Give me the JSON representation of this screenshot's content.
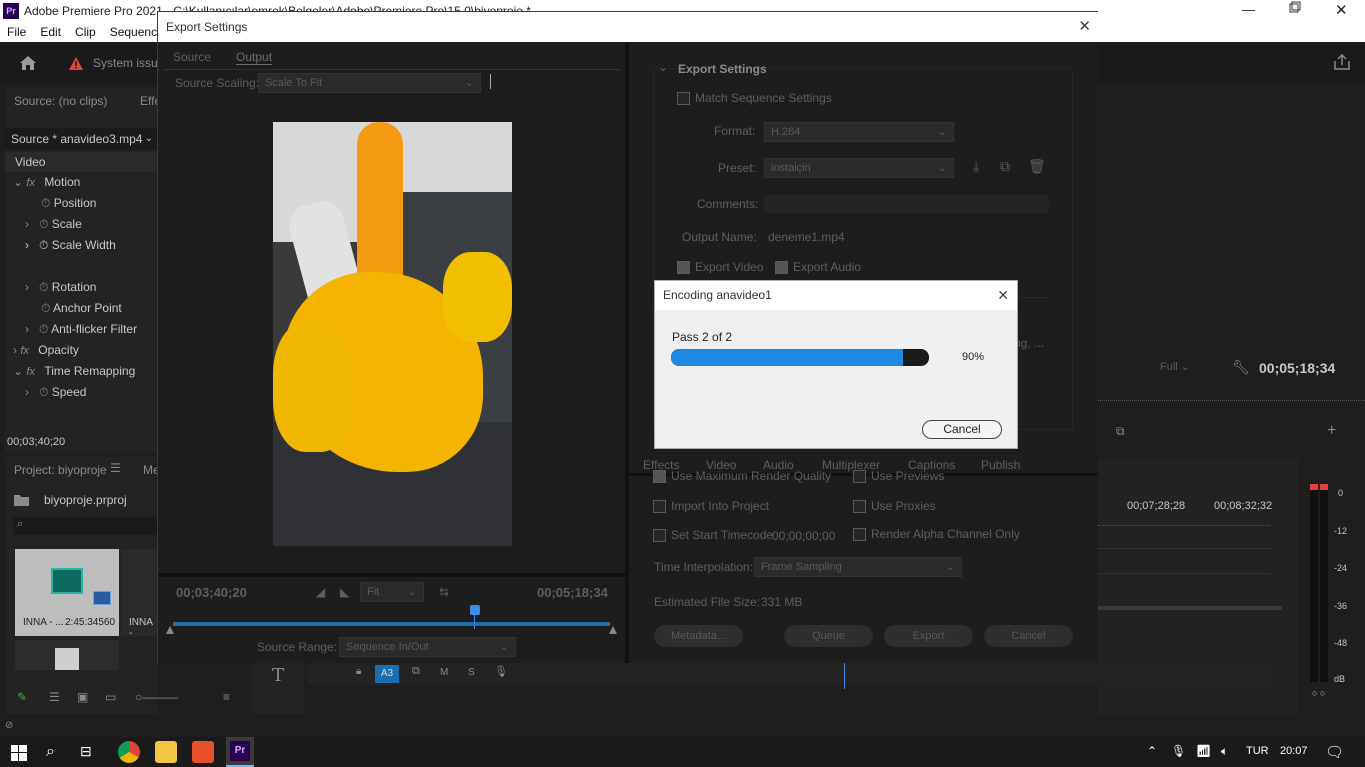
{
  "app": {
    "title": "Adobe Premiere Pro 2021 - C:\\Kullanıcılar\\emrek\\Belgeler\\Adobe\\Premiere Pro\\15.0\\biyoproje *",
    "logo": "Pr"
  },
  "menu": [
    "File",
    "Edit",
    "Clip",
    "Sequence"
  ],
  "header": {
    "system_issue": "System issue"
  },
  "source_panel": {
    "source_tab": "Source: (no clips)",
    "effects_tab": "Effe",
    "source_select": "Source * anavideo3.mp4",
    "video_label": "Video",
    "effects": [
      {
        "label": "Motion",
        "fx": "fx"
      },
      {
        "label": "Position"
      },
      {
        "label": "Scale"
      },
      {
        "label": "Scale Width"
      },
      {
        "label": ""
      },
      {
        "label": "Rotation"
      },
      {
        "label": "Anchor Point"
      },
      {
        "label": "Anti-flicker Filter"
      },
      {
        "label": "Opacity",
        "fx": "fx"
      },
      {
        "label": "Time Remapping",
        "fx": "fx"
      },
      {
        "label": "Speed"
      }
    ],
    "timecode": "00;03;40;20"
  },
  "project_panel": {
    "tab": "Project: biyoproje",
    "tab2": "Me",
    "file": "biyoproje.prproj",
    "clip1_name": "INNA - ...",
    "clip1_duration": "2:45:34560",
    "clip2_name": "INNA -"
  },
  "export_dialog": {
    "title": "Export Settings",
    "tabs": [
      "Source",
      "Output"
    ],
    "source_scaling_label": "Source Scaling:",
    "source_scaling_value": "Scale To Fit",
    "preview": {
      "timecode_left": "00;03;40;20",
      "fit": "Fit",
      "timecode_right": "00;05;18;34",
      "source_range_label": "Source Range:",
      "source_range_value": "Sequence In/Out",
      "playhead_progress": 0.69
    },
    "settings": {
      "section": "Export Settings",
      "match_sequence": "Match Sequence Settings",
      "format_label": "Format:",
      "format_value": "H.264",
      "preset_label": "Preset:",
      "preset_value": "instaiçin",
      "comments_label": "Comments:",
      "output_name_label": "Output Name:",
      "output_name_value": "deneme1.mp4",
      "export_video": "Export Video",
      "export_audio": "Export Audio",
      "summary_trunc": "ng, ..."
    },
    "bottom_tabs": [
      "Effects",
      "Video",
      "Audio",
      "Multiplexer",
      "Captions",
      "Publish"
    ],
    "options": {
      "max_render": "Use Maximum Render Quality",
      "use_previews": "Use Previews",
      "import_project": "Import Into Project",
      "use_proxies": "Use Proxies",
      "start_timecode": "Set Start Timecode",
      "start_timecode_value": "00;00;00;00",
      "alpha_only": "Render Alpha Channel Only",
      "time_interp_label": "Time Interpolation:",
      "time_interp_value": "Frame Sampling",
      "file_size_label": "Estimated File Size:",
      "file_size_value": "331 MB"
    },
    "buttons": {
      "metadata": "Metadata...",
      "queue": "Queue",
      "export": "Export",
      "cancel": "Cancel"
    }
  },
  "encoding": {
    "title": "Encoding anavideo1",
    "pass": "Pass 2 of 2",
    "progress": 0.9,
    "percent": "90%",
    "cancel": "Cancel"
  },
  "program_monitor": {
    "quality": "Full",
    "timecode": "00;05;18;34"
  },
  "timeline": {
    "tc1": "00;07;28;28",
    "tc2": "00;08;32;32",
    "track": "A3",
    "m": "M",
    "s": "S"
  },
  "audio_meter": {
    "labels": [
      "0",
      "-12",
      "-24",
      "-36",
      "-48",
      "dB"
    ]
  },
  "taskbar": {
    "lang": "TUR",
    "time": "20:07"
  },
  "colors": {
    "accent": "#1a7fd4",
    "progress": "#1e88e5",
    "bg": "#1d1d1d"
  }
}
